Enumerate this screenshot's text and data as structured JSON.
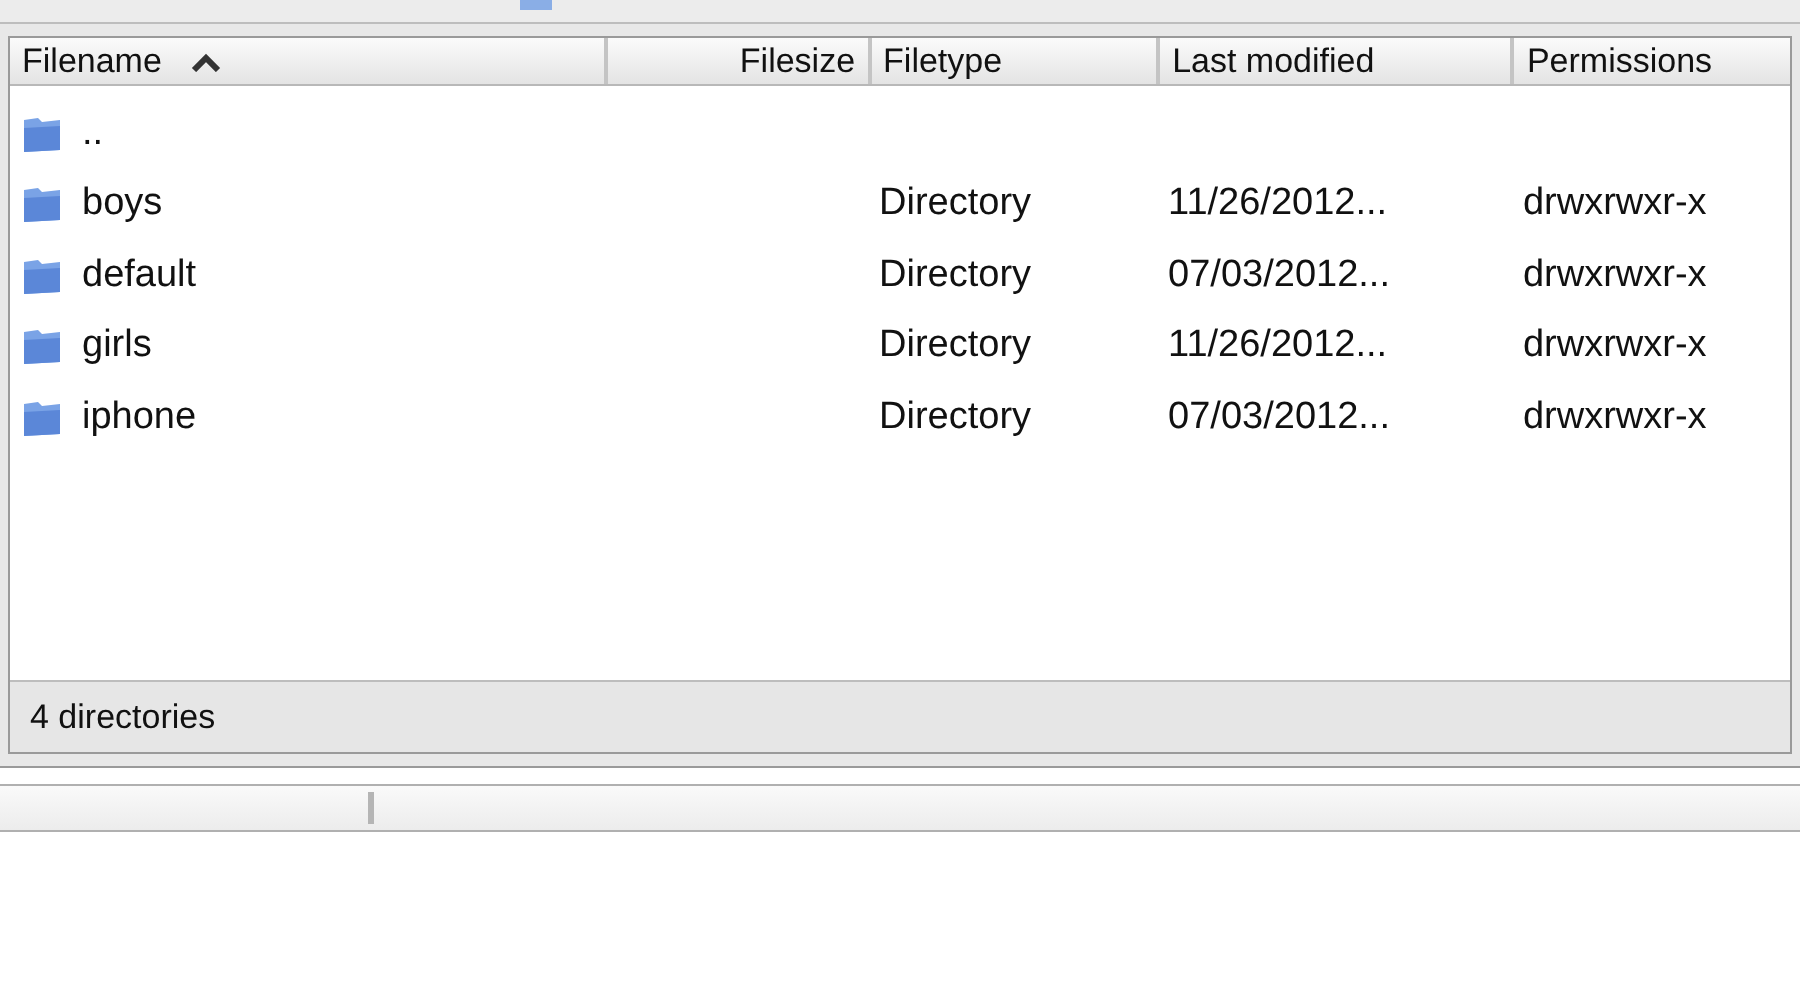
{
  "table": {
    "columns": [
      {
        "label": "Filename",
        "sorted": true
      },
      {
        "label": "Filesize",
        "sorted": false
      },
      {
        "label": "Filetype",
        "sorted": false
      },
      {
        "label": "Last modified",
        "sorted": false
      },
      {
        "label": "Permissions",
        "sorted": false
      }
    ],
    "rows": [
      {
        "filename": ".."
      },
      {
        "filename": "boys",
        "filetype": "Directory",
        "last_modified": "11/26/2012...",
        "permissions": "drwxrwxr-x"
      },
      {
        "filename": "default",
        "filetype": "Directory",
        "last_modified": "07/03/2012...",
        "permissions": "drwxrwxr-x"
      },
      {
        "filename": "girls",
        "filetype": "Directory",
        "last_modified": "11/26/2012...",
        "permissions": "drwxrwxr-x"
      },
      {
        "filename": "iphone",
        "filetype": "Directory",
        "last_modified": "07/03/2012...",
        "permissions": "drwxrwxr-x"
      }
    ]
  },
  "status_bar": "4 directories"
}
